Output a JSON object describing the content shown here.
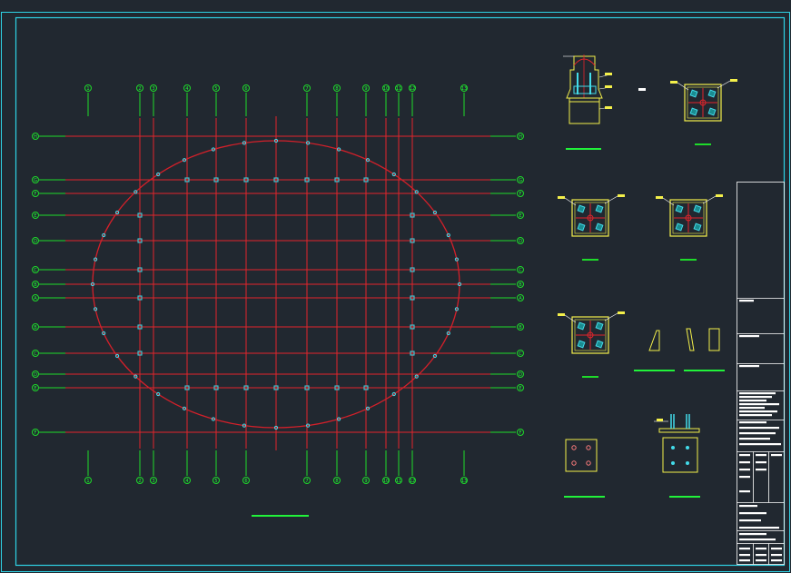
{
  "drawing": {
    "background": "#212830",
    "frame_color": "#2fd2e4",
    "gridline_color": "#e3252b",
    "ellipse_color": "#d4202a",
    "axis_color": "#1edb2a",
    "column_color": "#43dcea",
    "detail_outline_color": "#f4f04a",
    "note_color": "#ffffff"
  },
  "plan": {
    "x_axes": [
      "1",
      "2",
      "3",
      "4",
      "5",
      "6",
      "7",
      "8",
      "9",
      "10",
      "11",
      "12",
      "13"
    ],
    "y_axes": [
      "H",
      "G",
      "F",
      "E",
      "D",
      "C",
      "B",
      "A",
      "B",
      "C",
      "D",
      "E",
      "F",
      "G",
      "A"
    ]
  },
  "title_block": {
    "label": "title-block"
  }
}
